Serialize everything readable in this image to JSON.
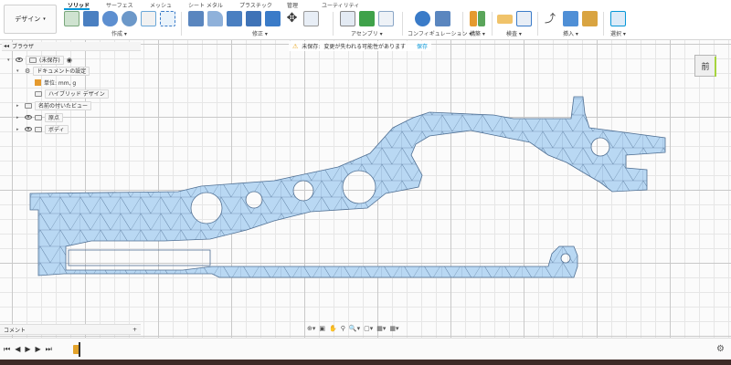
{
  "workspace": {
    "label": "デザイン",
    "caret": "▾"
  },
  "tabs": [
    {
      "label": "ソリッド",
      "active": true
    },
    {
      "label": "サーフェス"
    },
    {
      "label": "メッシュ"
    },
    {
      "label": "シート メタル"
    },
    {
      "label": "プラスチック"
    },
    {
      "label": "管理"
    },
    {
      "label": "ユーティリティ"
    }
  ],
  "groups": [
    {
      "label": "作成 ▾"
    },
    {
      "label": "修正 ▾"
    },
    {
      "label": "アセンブリ ▾"
    },
    {
      "label": "コンフィギュレーション ▾"
    },
    {
      "label": "構築 ▾"
    },
    {
      "label": "検査 ▾"
    },
    {
      "label": "挿入 ▾"
    },
    {
      "label": "選択 ▾"
    }
  ],
  "unsaved": {
    "icon": "⚠",
    "title": "未保存:",
    "message": "変更が失われる可能性があります",
    "save": "保存"
  },
  "browser": {
    "header": "ブラウザ",
    "root": "(未保存)",
    "doc_settings": "ドキュメントの設定",
    "units": "単位: mm, g",
    "design_type": "ハイブリッド デザイン",
    "named_views": "名前の付いたビュー",
    "origin": "原点",
    "bodies": "ボディ"
  },
  "comments": {
    "label": "コメント",
    "add": "+"
  },
  "viewcube": {
    "face": "前"
  },
  "navbar": {
    "items": [
      "⊕▾",
      "▣",
      "✋",
      "⚲",
      "🔍▾",
      "▢▾",
      "▦▾",
      "▦▾"
    ]
  },
  "timeline": {
    "controls": [
      "⏮",
      "◀",
      "▶",
      "▶",
      "⏭"
    ],
    "gear": "⚙"
  },
  "colors": {
    "accent": "#0696d7",
    "mesh_fill": "#b9d8f3",
    "mesh_stroke": "#4f6f93"
  }
}
